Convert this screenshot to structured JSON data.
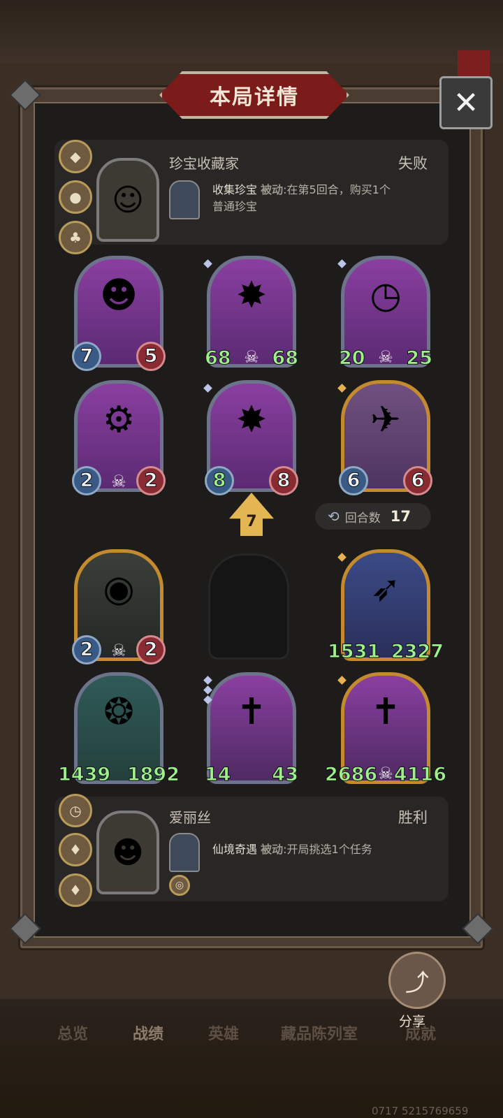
{
  "title": "本局详情",
  "close_icon": "✕",
  "opponent": {
    "name": "珍宝收藏家",
    "result": "失败",
    "skill_name": "收集珍宝",
    "skill_type": "被动",
    "skill_desc_line1": ":在第5回合，购买1个",
    "skill_desc_line2": "普通珍宝"
  },
  "opponent_board": [
    {
      "atk": "7",
      "hp": "5"
    },
    {
      "atk": "68",
      "hp": "68"
    },
    {
      "atk": "20",
      "hp": "25"
    },
    {
      "atk": "2",
      "hp": "2"
    },
    {
      "atk": "8",
      "hp": "8"
    },
    {
      "atk": "6",
      "hp": "6"
    }
  ],
  "level": "7",
  "turns_label": "回合数",
  "turns_value": "17",
  "player_board": [
    {
      "atk": "2",
      "hp": "2"
    },
    {
      "atk": "1531",
      "hp": "2327"
    },
    {
      "atk": "1439",
      "hp": "1892"
    },
    {
      "atk": "14",
      "hp": "43"
    },
    {
      "atk": "2686",
      "hp": "4116"
    }
  ],
  "player": {
    "name": "爱丽丝",
    "result": "胜利",
    "skill_name": "仙境奇遇",
    "skill_type": "被动",
    "skill_desc": ":开局挑选1个任务"
  },
  "share_label": "分享",
  "tabs": [
    "总览",
    "战绩",
    "英雄",
    "藏品陈列室",
    "成就"
  ],
  "uid": "0717 5215769659",
  "colors": {
    "accent_gold": "#e4b553",
    "banner_red": "#7b1c1a",
    "buff_green": "#9ef08a"
  }
}
